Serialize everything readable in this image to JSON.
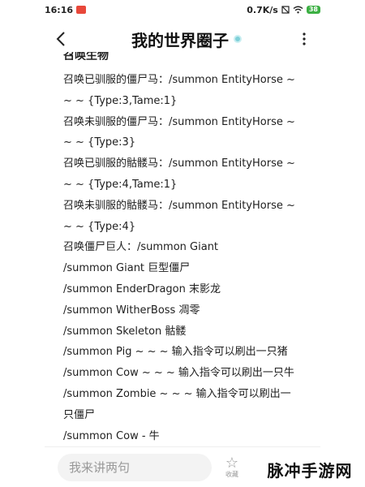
{
  "status_bar": {
    "time": "16:16",
    "network_speed": "0.7K/s",
    "battery_level": "38"
  },
  "header": {
    "title": "我的世界圈子"
  },
  "post": {
    "cut_heading": "召唤生物",
    "lines": [
      "召唤已驯服的僵尸马：/summon EntityHorse ~",
      "~ ~ {Type:3,Tame:1}",
      "召唤未驯服的僵尸马：/summon EntityHorse ~",
      "~ ~ {Type:3}",
      "召唤已驯服的骷髅马：/summon EntityHorse ~",
      "~ ~ {Type:4,Tame:1}",
      "召唤未驯服的骷髅马：/summon EntityHorse ~",
      "~ ~ {Type:4}",
      "召唤僵尸巨人：/summon Giant",
      "/summon Giant 巨型僵尸",
      "/summon EnderDragon 末影龙",
      "/summon WitherBoss 凋零",
      "/summon Skeleton 骷髅",
      "/summon Pig ~ ~ ~ 输入指令可以刷出一只猪",
      "/summon Cow ~ ~ ~ 输入指令可以刷出一只牛",
      "/summon Zombie ~ ~ ~ 输入指令可以刷出一",
      "只僵尸",
      "/summon Cow - 牛"
    ]
  },
  "bottom_bar": {
    "comment_placeholder": "我来讲两句",
    "star_label": "收藏"
  },
  "watermark": {
    "text": "脉冲手游网"
  },
  "icons": {
    "back": "back-arrow-icon",
    "more": "more-vertical-icon",
    "verified": "verified-badge-icon",
    "star": "star-icon"
  }
}
